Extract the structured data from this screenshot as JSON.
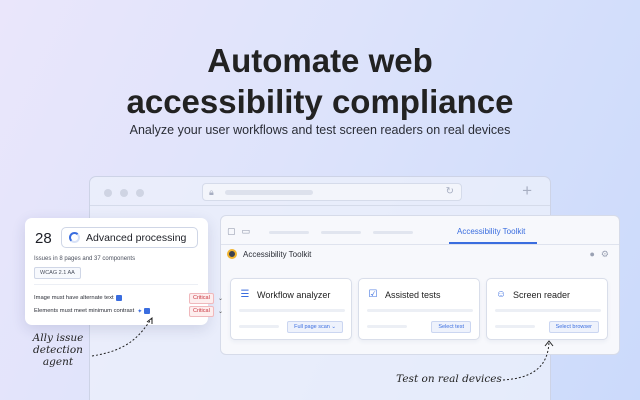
{
  "hero": {
    "title_line1": "Automate web",
    "title_line2": "accessibility compliance",
    "subtitle": "Analyze your user workflows and test screen readers on real devices"
  },
  "browser": {
    "url_icon": "lock-icon",
    "reload_icon": "reload-icon",
    "new_tab": "+"
  },
  "app": {
    "active_tab": "Accessibility Toolkit",
    "header_title": "Accessibility Toolkit",
    "cards": [
      {
        "icon": "workflow-icon",
        "title": "Workflow analyzer",
        "button": "Full page scan"
      },
      {
        "icon": "assisted-tests-icon",
        "title": "Assisted tests",
        "button": "Select test"
      },
      {
        "icon": "screen-reader-icon",
        "title": "Screen reader",
        "button": "Select browser"
      }
    ]
  },
  "issues": {
    "count": "28",
    "processing_label": "Advanced processing",
    "summary": "Issues in 8 pages and 37 components",
    "standard_badge": "WCAG 2.1 AA",
    "rows": [
      {
        "text": "Image must have alternate text",
        "severity": "Critical"
      },
      {
        "text": "Elements must meet minimum contrast",
        "severity": "Critical"
      }
    ]
  },
  "annotations": {
    "agent_line1": "Ally issue",
    "agent_line2": "detection",
    "agent_line3": "agent",
    "devices": "Test on real devices"
  },
  "colors": {
    "accent": "#3a6ddf",
    "critical": "#c9343f"
  }
}
